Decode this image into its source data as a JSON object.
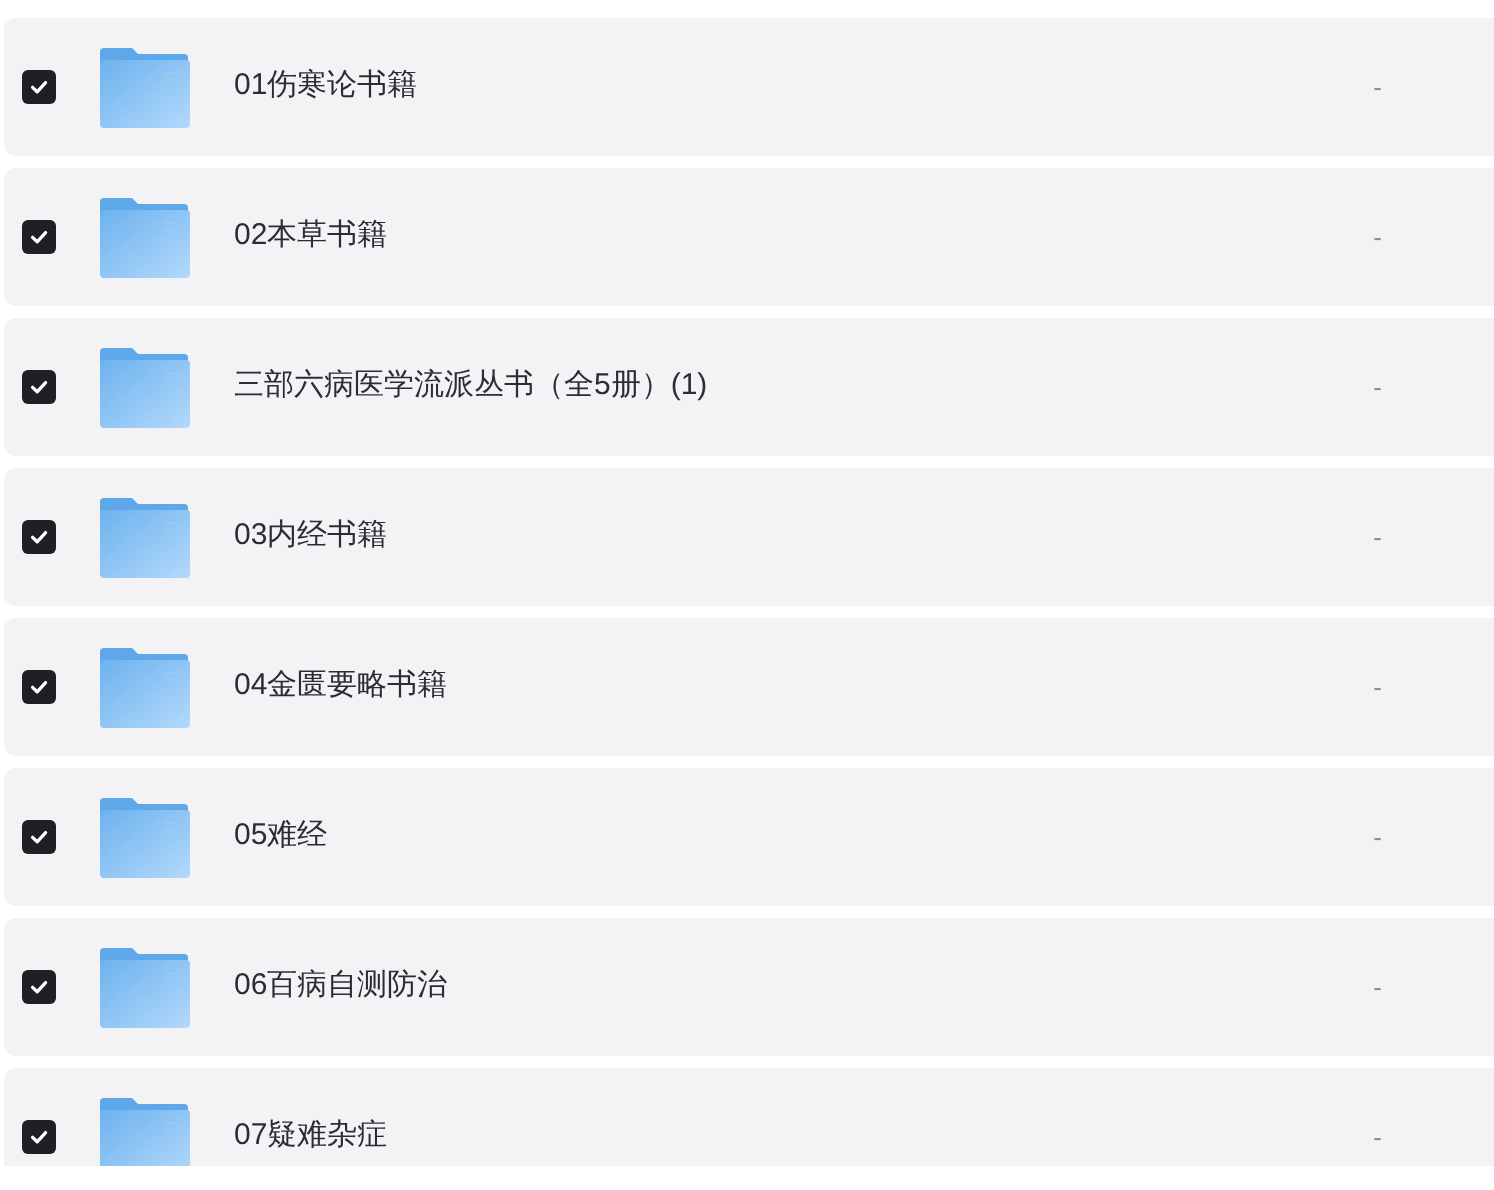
{
  "files": [
    {
      "name": "01伤寒论书籍",
      "size": "-",
      "checked": true
    },
    {
      "name": "02本草书籍",
      "size": "-",
      "checked": true
    },
    {
      "name": "三部六病医学流派丛书（全5册）(1)",
      "size": "-",
      "checked": true
    },
    {
      "name": "03内经书籍",
      "size": "-",
      "checked": true
    },
    {
      "name": "04金匮要略书籍",
      "size": "-",
      "checked": true
    },
    {
      "name": "05难经",
      "size": "-",
      "checked": true
    },
    {
      "name": "06百病自测防治",
      "size": "-",
      "checked": true
    },
    {
      "name": "07疑难杂症",
      "size": "-",
      "checked": true
    }
  ]
}
